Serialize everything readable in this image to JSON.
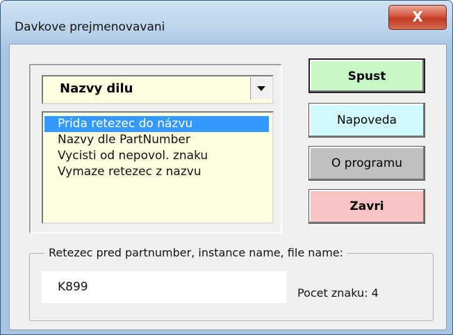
{
  "window": {
    "title": "Davkove prejmenovavani",
    "close_glyph": "X"
  },
  "combo": {
    "selected": "Nazvy dilu"
  },
  "list": {
    "items": [
      "Prida retezec do názvu",
      "Nazvy dle PartNumber",
      "Vycisti od nepovol. znaku",
      "Vymaze retezec z nazvu"
    ],
    "selected_index": 0
  },
  "buttons": {
    "run": "Spust",
    "help": "Napoveda",
    "about": "O programu",
    "close": "Zavri"
  },
  "group": {
    "label": "Retezec pred partnumber, instance name, file name:"
  },
  "input": {
    "value": "K899"
  },
  "counter": {
    "text": "Pocet znaku: 4"
  },
  "colors": {
    "run_bg": "#c8f7c8",
    "help_bg": "#cff9fb",
    "about_bg": "#c0c0c0",
    "close_bg": "#f7c3c3",
    "selection": "#3399ff",
    "list_bg": "#fffde0"
  }
}
